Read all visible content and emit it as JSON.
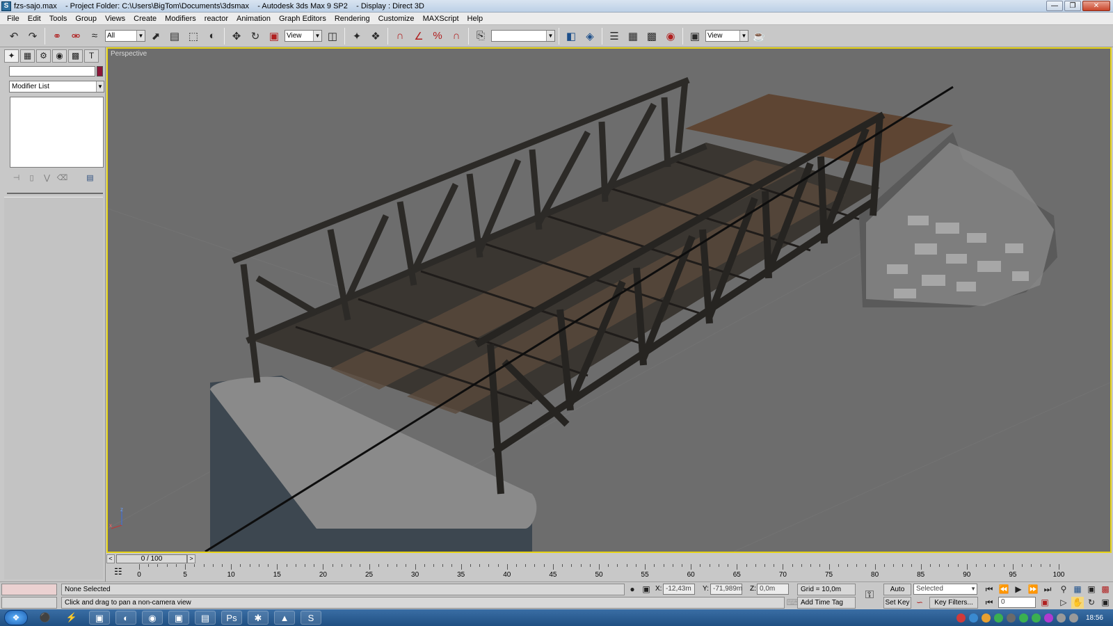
{
  "window": {
    "title": "fzs-sajo.max    - Project Folder: C:\\Users\\BigTom\\Documents\\3dsmax    - Autodesk 3ds Max 9 SP2    - Display : Direct 3D",
    "controls": [
      "minimize",
      "restore",
      "close"
    ]
  },
  "menu": [
    "File",
    "Edit",
    "Tools",
    "Group",
    "Views",
    "Create",
    "Modifiers",
    "reactor",
    "Animation",
    "Graph Editors",
    "Rendering",
    "Customize",
    "MAXScript",
    "Help"
  ],
  "toolbar": {
    "selection_filter": "All",
    "ref_coord_1": "View",
    "named_selection": "",
    "ref_coord_2": "View"
  },
  "command_panel": {
    "modifier_list": "Modifier List",
    "object_color": "#8c1538"
  },
  "viewport": {
    "label": "Perspective",
    "axis_z": "z",
    "axis_x": "x",
    "border_color": "#e6d316"
  },
  "time_slider": {
    "position": "0 / 100",
    "prev": "<",
    "next": ">"
  },
  "trackbar": {
    "labels": [
      "0",
      "5",
      "10",
      "15",
      "20",
      "25",
      "30",
      "35",
      "40",
      "45",
      "50",
      "55",
      "60",
      "65",
      "70",
      "75",
      "80",
      "85",
      "90",
      "95",
      "100"
    ]
  },
  "status": {
    "selection": "None Selected",
    "prompt": "Click and drag to pan a non-camera view",
    "x_label": "X:",
    "x_value": "-12,43m",
    "y_label": "Y:",
    "y_value": "-71,989m",
    "z_label": "Z:",
    "z_value": "0,0m",
    "grid": "Grid = 10,0m",
    "add_time_tag": "Add Time Tag",
    "auto_key": "Auto Key",
    "set_key": "Set Key",
    "key_mode": "Selected",
    "key_filters": "Key Filters...",
    "frame": "0"
  },
  "taskbar": {
    "clock": "18:56",
    "apps": [
      "firefox",
      "save",
      "chrome",
      "terminal",
      "explorer",
      "photoshop",
      "app-red",
      "3dsmax",
      "skype"
    ]
  }
}
